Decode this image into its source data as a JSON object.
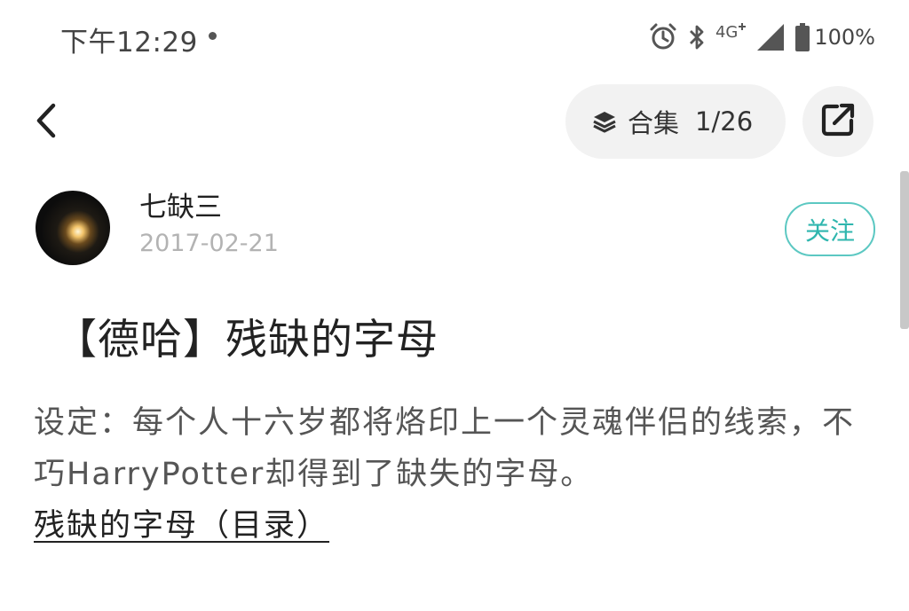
{
  "status_bar": {
    "time": "下午12:29",
    "network": "4G",
    "battery": "100%"
  },
  "header": {
    "collection_label": "合集",
    "collection_count": "1/26"
  },
  "author": {
    "name": "七缺三",
    "date": "2017-02-21",
    "follow_label": "关注"
  },
  "article": {
    "title": "【德哈】残缺的字母",
    "body": "设定：每个人十六岁都将烙印上一个灵魂伴侣的线索，不巧HarryPotter却得到了缺失的字母。",
    "toc_link": "残缺的字母（目录）"
  },
  "icons": {
    "back": "chevron-left-icon",
    "layers": "layers-icon",
    "share": "share-icon",
    "alarm": "alarm-icon",
    "bluetooth": "bluetooth-icon",
    "signal": "signal-icon",
    "battery": "battery-icon"
  },
  "colors": {
    "accent": "#2fb6ae",
    "pill_bg": "#f2f2f2",
    "date_gray": "#b3b3b3"
  }
}
